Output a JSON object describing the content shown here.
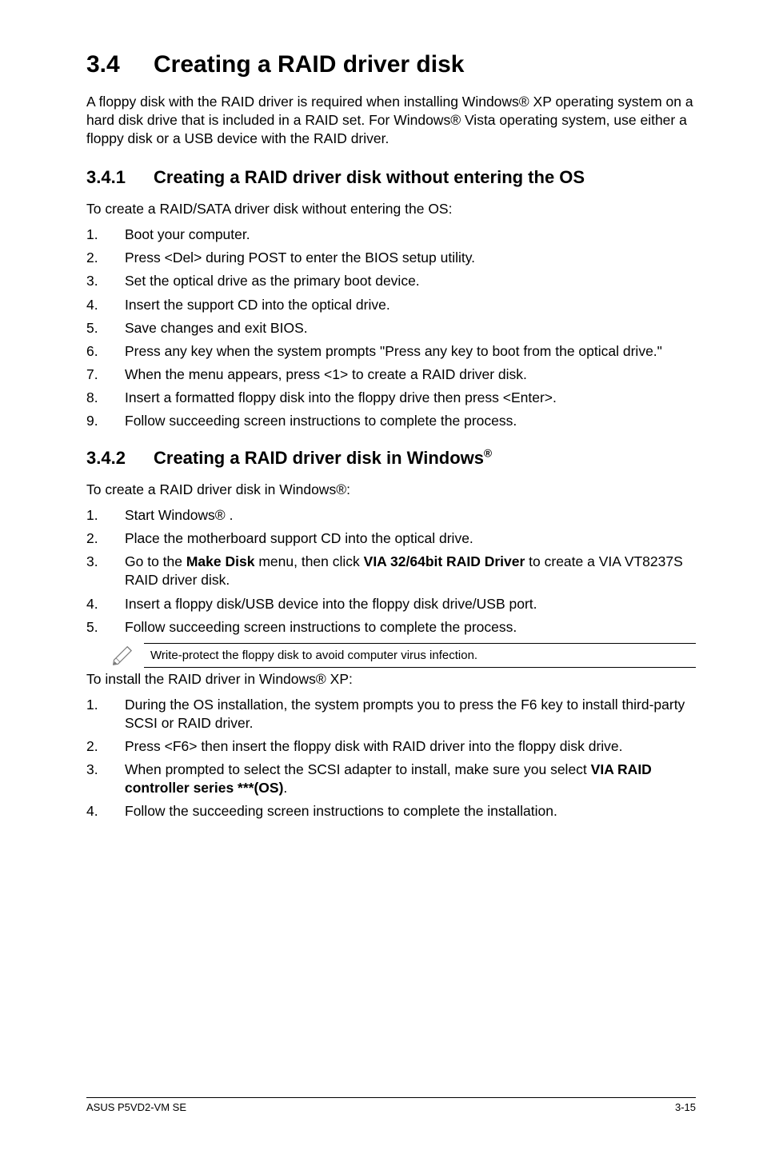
{
  "title": {
    "num": "3.4",
    "text": "Creating a RAID driver disk"
  },
  "intro": "A floppy disk with the RAID driver is required when installing Windows® XP operating system on a hard disk drive that is included in a RAID set. For Windows® Vista operating system, use either a floppy disk or a USB device with the RAID driver.",
  "sec1": {
    "num": "3.4.1",
    "title": "Creating a RAID driver disk without entering the OS",
    "lead": "To create a RAID/SATA driver disk without entering the OS:",
    "steps": [
      "Boot your computer.",
      "Press <Del> during POST to enter the BIOS setup utility.",
      "Set the optical drive as the primary boot device.",
      "Insert the support CD into the optical drive.",
      "Save changes and exit BIOS.",
      "Press any key when the system prompts \"Press any key to boot from the optical drive.\"",
      "When the menu appears, press <1> to create a RAID driver disk.",
      "Insert a formatted floppy disk into the floppy drive then press <Enter>.",
      "Follow succeeding screen instructions to complete the process."
    ]
  },
  "sec2": {
    "num": "3.4.2",
    "title_pre": "Creating a RAID driver disk in Windows",
    "title_sup": "®",
    "leadA": "To create a RAID driver disk in Windows®:",
    "partA": {
      "s1": "Start Windows® .",
      "s2": "Place the motherboard support CD into the optical drive.",
      "s3_pre": "Go to the ",
      "s3_b1": "Make Disk",
      "s3_mid": " menu, then click ",
      "s3_b2": "VIA 32/64bit RAID Driver",
      "s3_post": " to create a VIA VT8237S RAID driver disk.",
      "s4": "Insert a floppy disk/USB device into the floppy disk drive/USB port.",
      "s5": "Follow succeeding screen instructions to complete the process."
    },
    "note": "Write-protect the floppy disk to avoid computer virus infection.",
    "leadB": "To install the RAID driver in Windows® XP:",
    "partB": {
      "s1": "During the OS installation, the system prompts you to press the F6 key to install third-party SCSI or RAID driver.",
      "s2": "Press <F6> then insert the floppy disk with RAID driver into the floppy disk drive.",
      "s3_pre": "When prompted to select the SCSI adapter to install, make sure you select ",
      "s3_b": "VIA RAID controller series ***(OS)",
      "s3_post": ".",
      "s4": "Follow the succeeding screen instructions to complete the installation."
    }
  },
  "footer": {
    "left": "ASUS P5VD2-VM SE",
    "right": "3-15"
  }
}
